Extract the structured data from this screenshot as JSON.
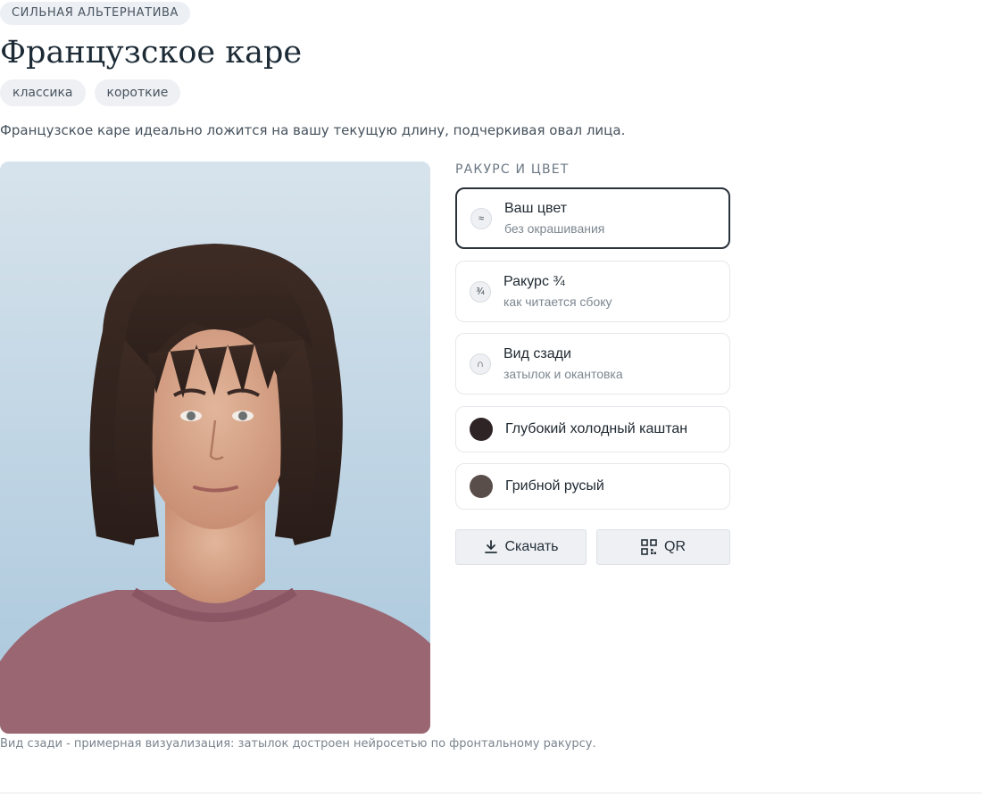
{
  "badge": "СИЛЬНАЯ АЛЬТЕРНАТИВА",
  "title": "Французское каре",
  "tags": [
    "классика",
    "короткие"
  ],
  "description": "Французское каре идеально ложится на вашу текущую длину, подчеркивая овал лица.",
  "caption": "Вид сзади - примерная визуализация: затылок достроен нейросетью по фронтальному ракурсу.",
  "panel": {
    "section_label": "РАКУРС И ЦВЕТ",
    "options": [
      {
        "title": "Ваш цвет",
        "subtitle": "без окрашивания",
        "icon": "≈",
        "icon_name": "color-wave-icon",
        "selected": true
      },
      {
        "title": "Ракурс ¾",
        "subtitle": "как читается сбоку",
        "icon": "¾",
        "icon_name": "three-quarter-icon",
        "selected": false
      },
      {
        "title": "Вид сзади",
        "subtitle": "затылок и окантовка",
        "icon": "∩",
        "icon_name": "back-view-icon",
        "selected": false
      }
    ],
    "colors": [
      {
        "title": "Глубокий холодный каштан",
        "swatch": "#2e2325"
      },
      {
        "title": "Грибной русый",
        "swatch": "#5a4e4a"
      }
    ],
    "download_label": "Скачать",
    "qr_label": "QR"
  },
  "colors": {
    "selected_border": "#2a323a",
    "tag_bg": "#eef0f4",
    "photo_bg": "#c9dbe7",
    "shirt": "#9a6672",
    "hair": "#3a2a24",
    "skin": "#d9a88c"
  }
}
